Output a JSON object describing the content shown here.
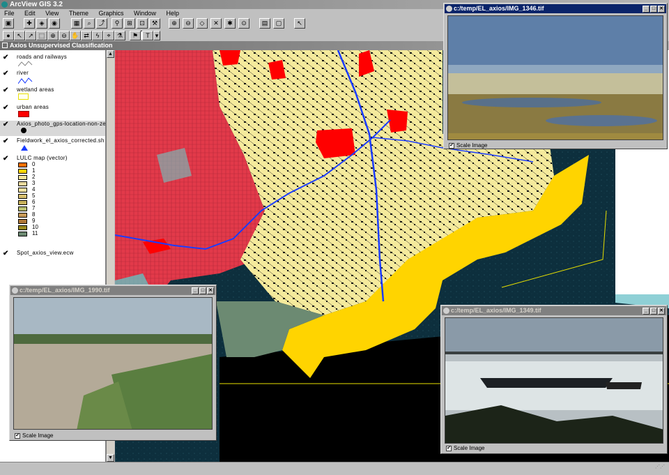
{
  "app": {
    "title": "ArcView GIS 3.2"
  },
  "menu": [
    "File",
    "Edit",
    "View",
    "Theme",
    "Graphics",
    "Window",
    "Help"
  ],
  "view": {
    "title": "Axios Unsupervised Classification",
    "themes": [
      {
        "name": "roads and railways",
        "visible": true
      },
      {
        "name": "river",
        "visible": true
      },
      {
        "name": "wetland areas",
        "visible": true
      },
      {
        "name": "urban areas",
        "visible": true
      },
      {
        "name": "Axios_photo_gps-location-non-ze",
        "visible": true
      },
      {
        "name": "Fieldwork_el_axios_corrected.sh",
        "visible": true
      },
      {
        "name": "LULC map (vector)",
        "visible": true
      },
      {
        "name": "Spot_axios_view.ecw",
        "visible": true
      }
    ],
    "lulc_classes": [
      {
        "label": "0",
        "color": "#f07000"
      },
      {
        "label": "1",
        "color": "#ffd400"
      },
      {
        "label": "2",
        "color": "#f5e59a"
      },
      {
        "label": "3",
        "color": "#e8d99e"
      },
      {
        "label": "4",
        "color": "#efe1a0"
      },
      {
        "label": "5",
        "color": "#d8c070"
      },
      {
        "label": "6",
        "color": "#c8b25c"
      },
      {
        "label": "7",
        "color": "#b8c070"
      },
      {
        "label": "8",
        "color": "#c89a58"
      },
      {
        "label": "9",
        "color": "#b07838"
      },
      {
        "label": "10",
        "color": "#9a8a20"
      },
      {
        "label": "11",
        "color": "#6c8a72"
      }
    ]
  },
  "windows": {
    "img1346": {
      "title": "c:/temp/EL_axios/IMG_1346.tif",
      "scale_label": "Scale Image"
    },
    "img1990": {
      "title": "c:/temp/EL_axios/IMG_1990.tif",
      "scale_label": "Scale Image"
    },
    "img1349": {
      "title": "c:/temp/EL_axios/IMG_1349.tif",
      "scale_label": "Scale Image"
    }
  }
}
